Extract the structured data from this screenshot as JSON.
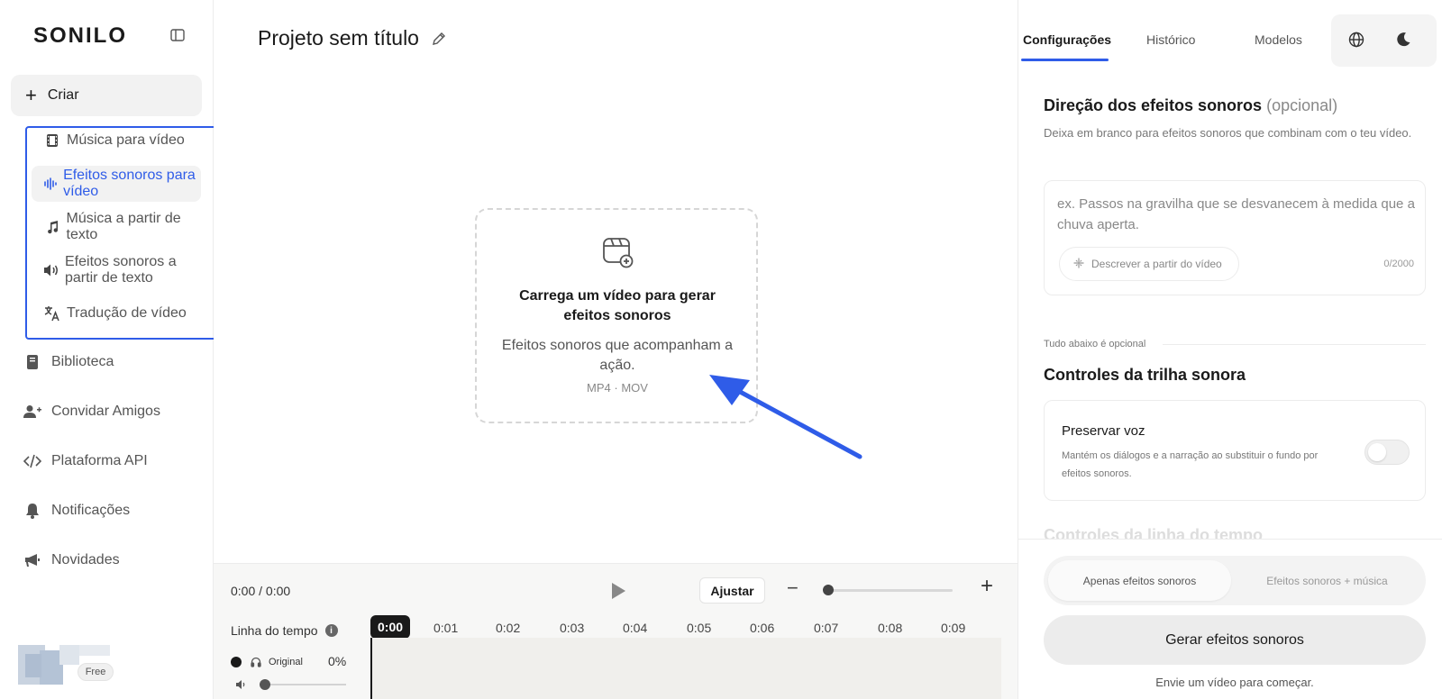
{
  "sidebar": {
    "logo": "SONILO",
    "create_label": "Criar",
    "sub_items": [
      {
        "label": "Música para vídeo",
        "icon": "film-icon"
      },
      {
        "label": "Efeitos sonoros para vídeo",
        "icon": "waveform-icon"
      },
      {
        "label": "Música a partir de texto",
        "icon": "music-note-icon"
      },
      {
        "label": "Efeitos sonoros a partir de texto",
        "icon": "speaker-icon"
      },
      {
        "label": "Tradução de vídeo",
        "icon": "translate-icon"
      }
    ],
    "nav_items": [
      {
        "label": "Biblioteca",
        "icon": "book-icon"
      },
      {
        "label": "Convidar Amigos",
        "icon": "add-user-icon"
      },
      {
        "label": "Plataforma API",
        "icon": "code-icon"
      },
      {
        "label": "Notificações",
        "icon": "bell-icon"
      },
      {
        "label": "Novidades",
        "icon": "megaphone-icon"
      }
    ],
    "plan_badge": "Free"
  },
  "main": {
    "project_title": "Projeto sem título",
    "upload": {
      "title": "Carrega um vídeo para gerar efeitos sonoros",
      "subtitle": "Efeitos sonoros que acompanham a ação.",
      "formats": "MP4 · MOV"
    }
  },
  "timeline": {
    "time_display": "0:00 / 0:00",
    "adjust_label": "Ajustar",
    "label": "Linha do tempo",
    "ticks": [
      "0:00",
      "0:01",
      "0:02",
      "0:03",
      "0:04",
      "0:05",
      "0:06",
      "0:07",
      "0:08",
      "0:09"
    ],
    "original_label": "Original",
    "original_percent": "0%"
  },
  "right_panel": {
    "tabs": [
      "Configurações",
      "Histórico",
      "Modelos"
    ],
    "direction": {
      "title": "Direção dos efeitos sonoros",
      "optional": "(opcional)",
      "description": "Deixa em branco para efeitos sonoros que combinam com o teu vídeo.",
      "placeholder": "ex. Passos na gravilha que se desvanecem à medida que a chuva aperta.",
      "describe_button": "Descrever a partir do vídeo",
      "char_count": "0/2000"
    },
    "optional_note": "Tudo abaixo é opcional",
    "controls_title": "Controles da trilha sonora",
    "preserve_voice": {
      "title": "Preservar voz",
      "description": "Mantém os diálogos e a narração ao substituir o fundo por efeitos sonoros."
    },
    "faded_section": "Controles da linha do tempo",
    "mode_options": [
      "Apenas efeitos sonoros",
      "Efeitos sonoros + música"
    ],
    "generate_label": "Gerar efeitos sonoros",
    "generate_hint": "Envie um vídeo para começar."
  },
  "colors": {
    "accent": "#2f5ce8",
    "highlight_box": "#2f5ce8"
  }
}
